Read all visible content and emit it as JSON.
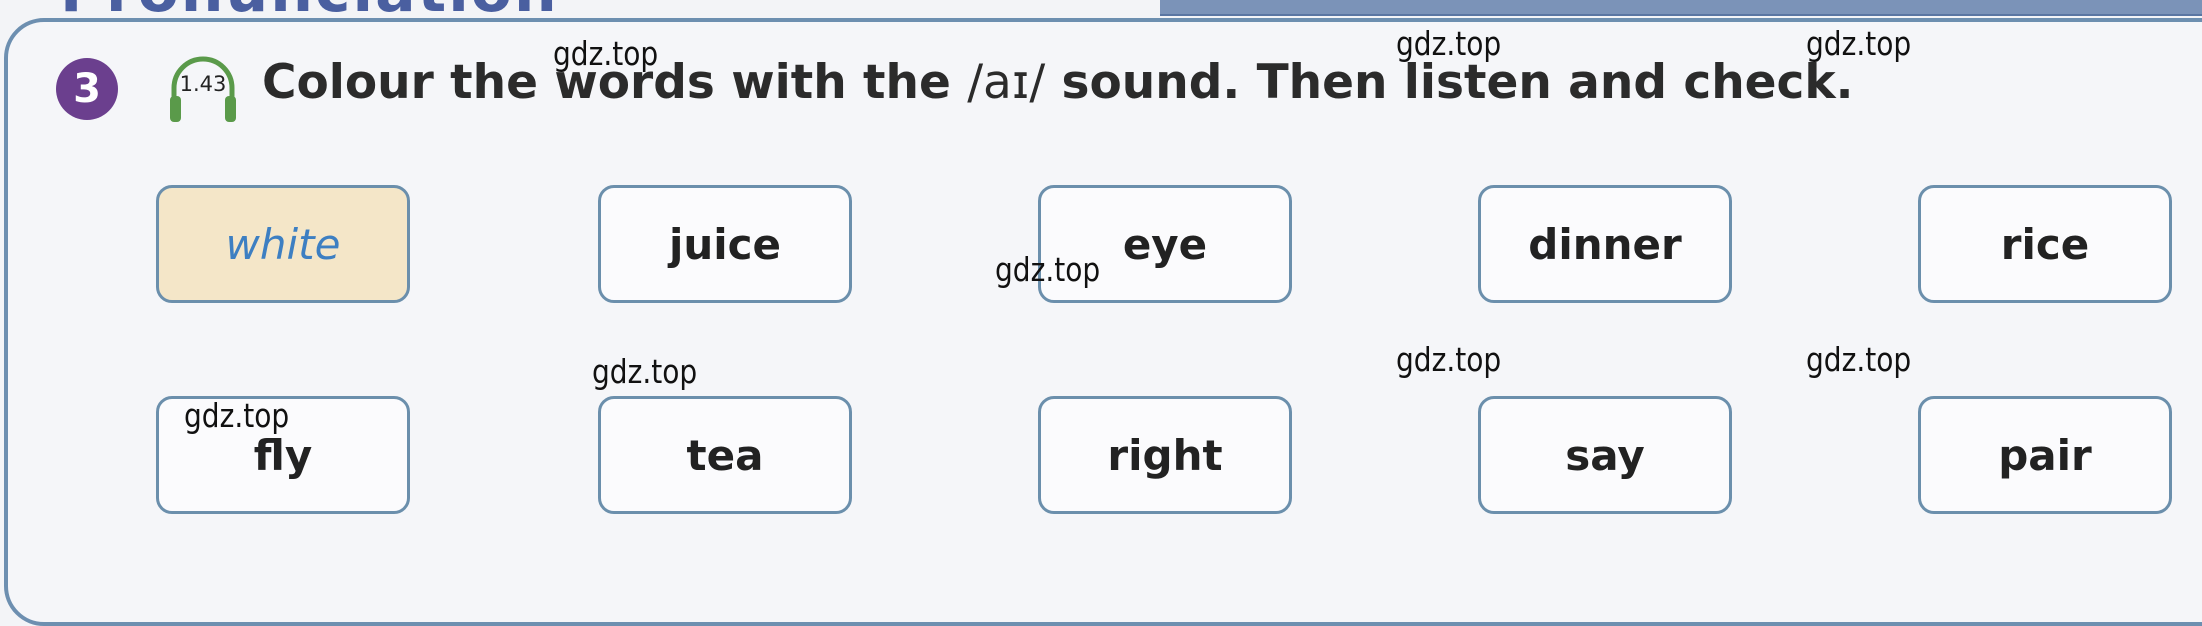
{
  "section_title": "Pronunciation",
  "exercise": {
    "number": "3",
    "audio_track": "1.43",
    "audio_icon": "headphones-icon",
    "instruction_before": "Colour the words with the ",
    "ipa": "/aɪ/",
    "instruction_after": " sound. Then listen and check."
  },
  "words": [
    {
      "text": "white",
      "coloured": true
    },
    {
      "text": "juice",
      "coloured": false
    },
    {
      "text": "eye",
      "coloured": false
    },
    {
      "text": "dinner",
      "coloured": false
    },
    {
      "text": "rice",
      "coloured": false
    },
    {
      "text": "fly",
      "coloured": false
    },
    {
      "text": "tea",
      "coloured": false
    },
    {
      "text": "right",
      "coloured": false
    },
    {
      "text": "say",
      "coloured": false
    },
    {
      "text": "pair",
      "coloured": false
    }
  ],
  "colors": {
    "badge": "#6b3f8e",
    "coloured_fill": "#f4e6c8",
    "coloured_text": "#3d7fc2",
    "box_border": "#6b8fac",
    "headphones": "#5a9a4a"
  },
  "watermarks": [
    "gdz.top",
    "gdz.top",
    "gdz.top",
    "gdz.top",
    "gdz.top",
    "gdz.top",
    "gdz.top",
    "gdz.top"
  ]
}
